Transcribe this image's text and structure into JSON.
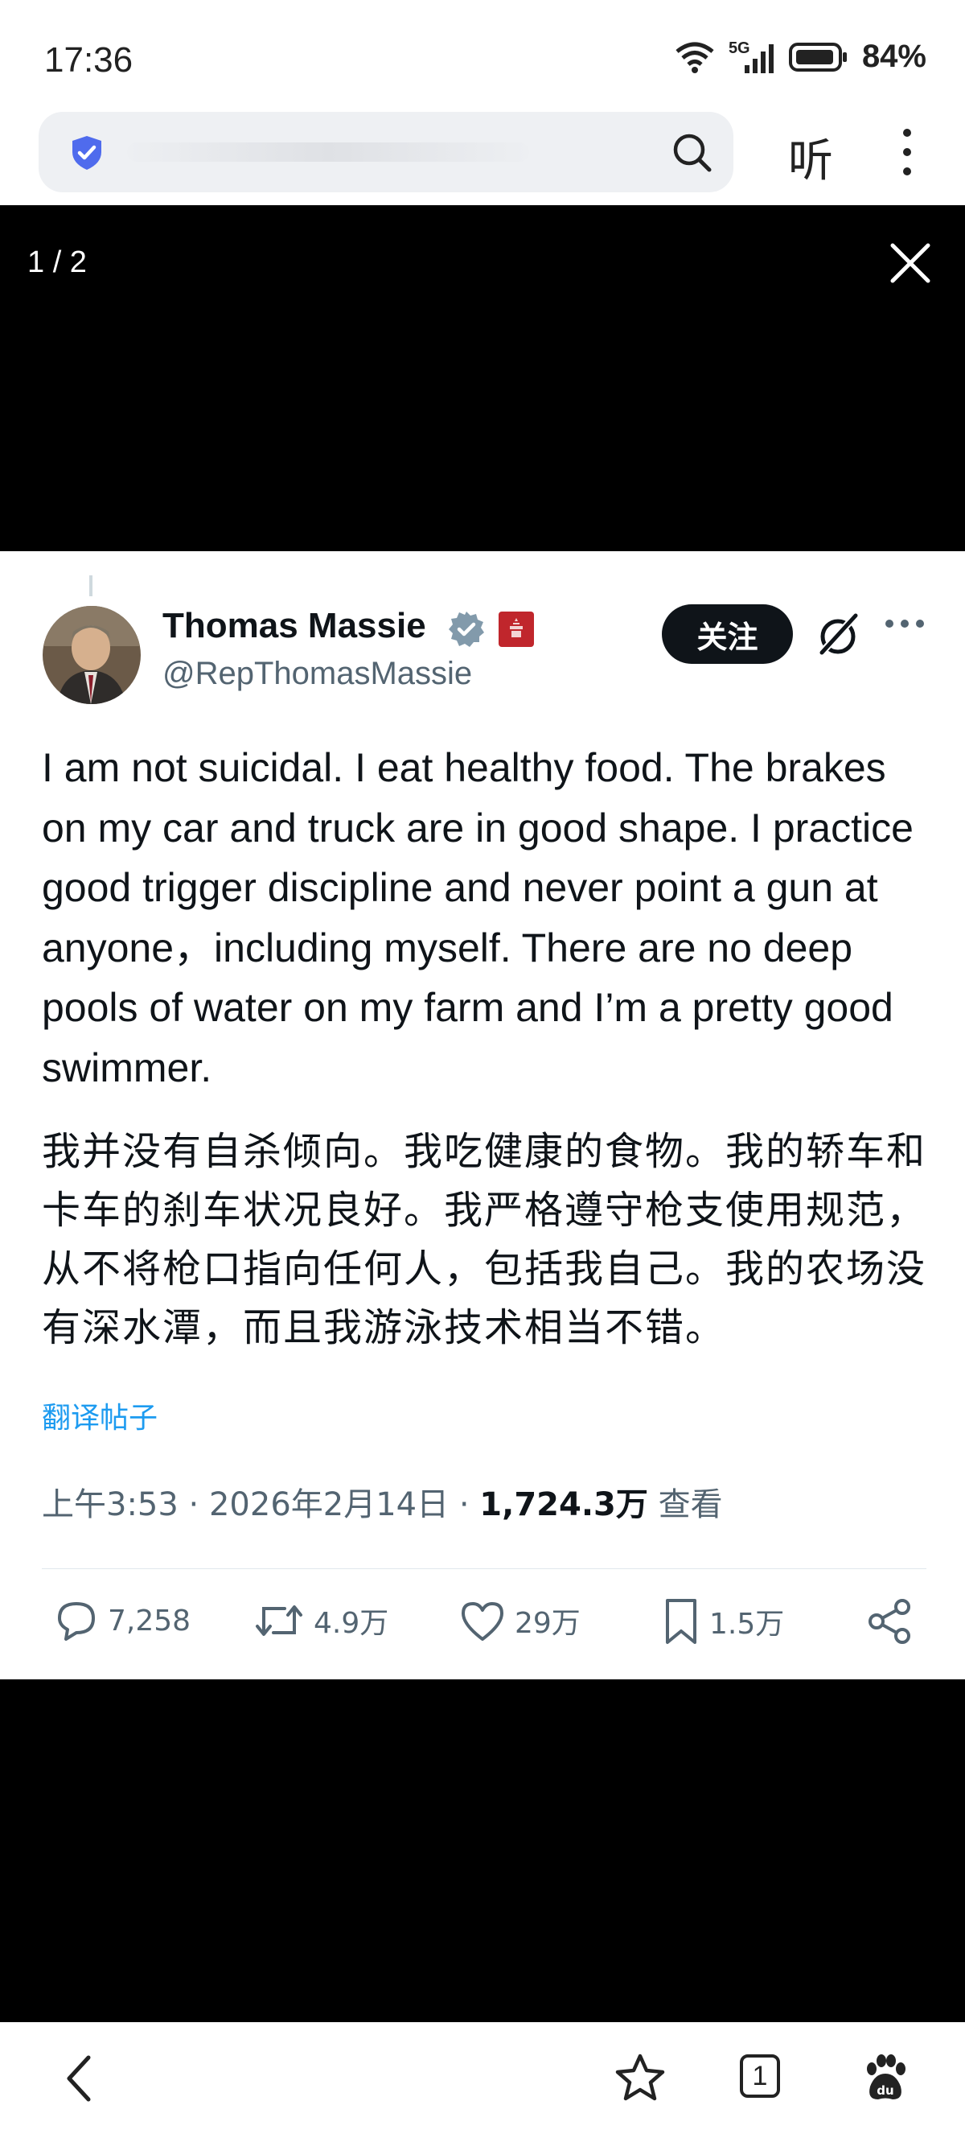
{
  "status_bar": {
    "time": "17:36",
    "network": "5G",
    "battery": "84%"
  },
  "browser": {
    "listen_label": "听"
  },
  "viewer": {
    "page_counter": "1 / 2"
  },
  "tweet": {
    "display_name": "Thomas Massie",
    "handle": "@RepThomasMassie",
    "follow_label": "关注",
    "text_en": "I am not suicidal. I eat healthy food. The brakes on my car and truck are in good shape. I practice good trigger discipline and never point a gun at anyone，including myself. There are no deep pools of water on my farm and I’m a pretty good swimmer.",
    "text_zh": "我并没有自杀倾向。我吃健康的食物。我的轿车和卡车的刹车状况良好。我严格遵守枪支使用规范，从不将枪口指向任何人，包括我自己。我的农场没有深水潭，而且我游泳技术相当不错。",
    "translate_label": "翻译帖子",
    "time": "上午3:53",
    "date": "2026年2月14日",
    "views": "1,724.3万",
    "views_label": "查看",
    "actions": {
      "replies": "7,258",
      "reposts": "4.9万",
      "likes": "29万",
      "bookmarks": "1.5万"
    }
  },
  "nav": {
    "tab_count": "1"
  },
  "colors": {
    "follow_bg": "#0f1419",
    "link": "#1d9bf0",
    "verified": "#829aab",
    "gov_badge": "#c0262c",
    "shield": "#4f6bed"
  },
  "icons": [
    "shield-icon",
    "search-icon",
    "more-vertical-icon",
    "close-icon",
    "verified-icon",
    "gov-badge-icon",
    "grok-icon",
    "more-horizontal-icon",
    "reply-icon",
    "repost-icon",
    "like-icon",
    "bookmark-icon",
    "share-icon",
    "back-icon",
    "star-icon",
    "tabs-icon",
    "baidu-paw-icon"
  ]
}
